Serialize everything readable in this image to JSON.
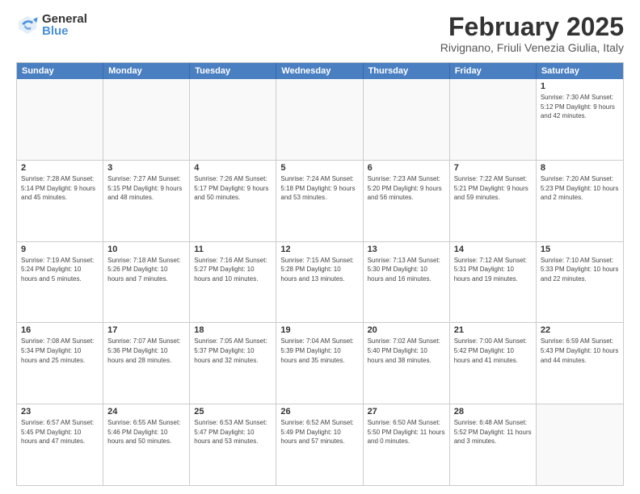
{
  "logo": {
    "general": "General",
    "blue": "Blue"
  },
  "calendar": {
    "title": "February 2025",
    "subtitle": "Rivignano, Friuli Venezia Giulia, Italy",
    "headers": [
      "Sunday",
      "Monday",
      "Tuesday",
      "Wednesday",
      "Thursday",
      "Friday",
      "Saturday"
    ],
    "rows": [
      [
        {
          "day": "",
          "info": ""
        },
        {
          "day": "",
          "info": ""
        },
        {
          "day": "",
          "info": ""
        },
        {
          "day": "",
          "info": ""
        },
        {
          "day": "",
          "info": ""
        },
        {
          "day": "",
          "info": ""
        },
        {
          "day": "1",
          "info": "Sunrise: 7:30 AM\nSunset: 5:12 PM\nDaylight: 9 hours\nand 42 minutes."
        }
      ],
      [
        {
          "day": "2",
          "info": "Sunrise: 7:28 AM\nSunset: 5:14 PM\nDaylight: 9 hours\nand 45 minutes."
        },
        {
          "day": "3",
          "info": "Sunrise: 7:27 AM\nSunset: 5:15 PM\nDaylight: 9 hours\nand 48 minutes."
        },
        {
          "day": "4",
          "info": "Sunrise: 7:26 AM\nSunset: 5:17 PM\nDaylight: 9 hours\nand 50 minutes."
        },
        {
          "day": "5",
          "info": "Sunrise: 7:24 AM\nSunset: 5:18 PM\nDaylight: 9 hours\nand 53 minutes."
        },
        {
          "day": "6",
          "info": "Sunrise: 7:23 AM\nSunset: 5:20 PM\nDaylight: 9 hours\nand 56 minutes."
        },
        {
          "day": "7",
          "info": "Sunrise: 7:22 AM\nSunset: 5:21 PM\nDaylight: 9 hours\nand 59 minutes."
        },
        {
          "day": "8",
          "info": "Sunrise: 7:20 AM\nSunset: 5:23 PM\nDaylight: 10 hours\nand 2 minutes."
        }
      ],
      [
        {
          "day": "9",
          "info": "Sunrise: 7:19 AM\nSunset: 5:24 PM\nDaylight: 10 hours\nand 5 minutes."
        },
        {
          "day": "10",
          "info": "Sunrise: 7:18 AM\nSunset: 5:26 PM\nDaylight: 10 hours\nand 7 minutes."
        },
        {
          "day": "11",
          "info": "Sunrise: 7:16 AM\nSunset: 5:27 PM\nDaylight: 10 hours\nand 10 minutes."
        },
        {
          "day": "12",
          "info": "Sunrise: 7:15 AM\nSunset: 5:28 PM\nDaylight: 10 hours\nand 13 minutes."
        },
        {
          "day": "13",
          "info": "Sunrise: 7:13 AM\nSunset: 5:30 PM\nDaylight: 10 hours\nand 16 minutes."
        },
        {
          "day": "14",
          "info": "Sunrise: 7:12 AM\nSunset: 5:31 PM\nDaylight: 10 hours\nand 19 minutes."
        },
        {
          "day": "15",
          "info": "Sunrise: 7:10 AM\nSunset: 5:33 PM\nDaylight: 10 hours\nand 22 minutes."
        }
      ],
      [
        {
          "day": "16",
          "info": "Sunrise: 7:08 AM\nSunset: 5:34 PM\nDaylight: 10 hours\nand 25 minutes."
        },
        {
          "day": "17",
          "info": "Sunrise: 7:07 AM\nSunset: 5:36 PM\nDaylight: 10 hours\nand 28 minutes."
        },
        {
          "day": "18",
          "info": "Sunrise: 7:05 AM\nSunset: 5:37 PM\nDaylight: 10 hours\nand 32 minutes."
        },
        {
          "day": "19",
          "info": "Sunrise: 7:04 AM\nSunset: 5:39 PM\nDaylight: 10 hours\nand 35 minutes."
        },
        {
          "day": "20",
          "info": "Sunrise: 7:02 AM\nSunset: 5:40 PM\nDaylight: 10 hours\nand 38 minutes."
        },
        {
          "day": "21",
          "info": "Sunrise: 7:00 AM\nSunset: 5:42 PM\nDaylight: 10 hours\nand 41 minutes."
        },
        {
          "day": "22",
          "info": "Sunrise: 6:59 AM\nSunset: 5:43 PM\nDaylight: 10 hours\nand 44 minutes."
        }
      ],
      [
        {
          "day": "23",
          "info": "Sunrise: 6:57 AM\nSunset: 5:45 PM\nDaylight: 10 hours\nand 47 minutes."
        },
        {
          "day": "24",
          "info": "Sunrise: 6:55 AM\nSunset: 5:46 PM\nDaylight: 10 hours\nand 50 minutes."
        },
        {
          "day": "25",
          "info": "Sunrise: 6:53 AM\nSunset: 5:47 PM\nDaylight: 10 hours\nand 53 minutes."
        },
        {
          "day": "26",
          "info": "Sunrise: 6:52 AM\nSunset: 5:49 PM\nDaylight: 10 hours\nand 57 minutes."
        },
        {
          "day": "27",
          "info": "Sunrise: 6:50 AM\nSunset: 5:50 PM\nDaylight: 11 hours\nand 0 minutes."
        },
        {
          "day": "28",
          "info": "Sunrise: 6:48 AM\nSunset: 5:52 PM\nDaylight: 11 hours\nand 3 minutes."
        },
        {
          "day": "",
          "info": ""
        }
      ]
    ]
  }
}
